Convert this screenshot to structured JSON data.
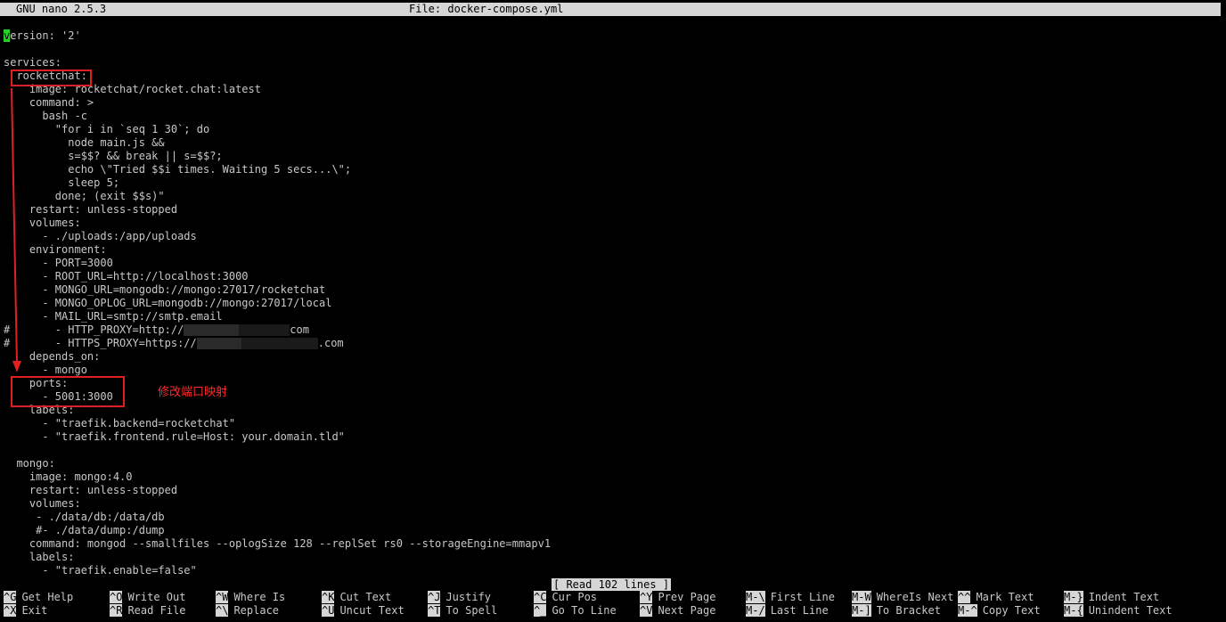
{
  "titlebar": {
    "app": "GNU nano 2.5.3",
    "file": "File: docker-compose.yml"
  },
  "editor": {
    "first_char": "v",
    "first_rest": "ersion: '2'",
    "lines": [
      "",
      "services:",
      "  rocketchat:",
      "    image: rocketchat/rocket.chat:latest",
      "    command: >",
      "      bash -c",
      "        \"for i in `seq 1 30`; do",
      "          node main.js &&",
      "          s=$$? && break || s=$$?;",
      "          echo \\\"Tried $$i times. Waiting 5 secs...\\\";",
      "          sleep 5;",
      "        done; (exit $$s)\"",
      "    restart: unless-stopped",
      "    volumes:",
      "      - ./uploads:/app/uploads",
      "    environment:",
      "      - PORT=3000",
      "      - ROOT_URL=http://localhost:3000",
      "      - MONGO_URL=mongodb://mongo:27017/rocketchat",
      "      - MONGO_OPLOG_URL=mongodb://mongo:27017/local",
      "      - MAIL_URL=smtp://smtp.email"
    ],
    "proxy_lines": [
      {
        "prefix": "#       - HTTP_PROXY=http://",
        "suffix": "com"
      },
      {
        "prefix": "#       - HTTPS_PROXY=https://",
        "suffix": ".com"
      }
    ],
    "lines2": [
      "    depends_on:",
      "      - mongo",
      "    ports:",
      "      - 5001:3000",
      "    labels:",
      "      - \"traefik.backend=rocketchat\"",
      "      - \"traefik.frontend.rule=Host: your.domain.tld\"",
      "",
      "  mongo:",
      "    image: mongo:4.0",
      "    restart: unless-stopped",
      "    volumes:",
      "     - ./data/db:/data/db",
      "     #- ./data/dump:/dump",
      "    command: mongod --smallfiles --oplogSize 128 --replSet rs0 --storageEngine=mmapv1",
      "    labels:",
      "      - \"traefik.enable=false\""
    ]
  },
  "status": "[ Read 102 lines ]",
  "shortcuts": [
    [
      {
        "key": "^G",
        "label": "Get Help"
      },
      {
        "key": "^X",
        "label": "Exit"
      }
    ],
    [
      {
        "key": "^O",
        "label": "Write Out"
      },
      {
        "key": "^R",
        "label": "Read File"
      }
    ],
    [
      {
        "key": "^W",
        "label": "Where Is"
      },
      {
        "key": "^\\",
        "label": "Replace"
      }
    ],
    [
      {
        "key": "^K",
        "label": "Cut Text"
      },
      {
        "key": "^U",
        "label": "Uncut Text"
      }
    ],
    [
      {
        "key": "^J",
        "label": "Justify"
      },
      {
        "key": "^T",
        "label": "To Spell"
      }
    ],
    [
      {
        "key": "^C",
        "label": "Cur Pos"
      },
      {
        "key": "^_",
        "label": "Go To Line"
      }
    ],
    [
      {
        "key": "^Y",
        "label": "Prev Page"
      },
      {
        "key": "^V",
        "label": "Next Page"
      }
    ],
    [
      {
        "key": "M-\\",
        "label": "First Line"
      },
      {
        "key": "M-/",
        "label": "Last Line"
      }
    ],
    [
      {
        "key": "M-W",
        "label": "WhereIs Next"
      },
      {
        "key": "M-]",
        "label": "To Bracket"
      }
    ],
    [
      {
        "key": "^^",
        "label": "Mark Text"
      },
      {
        "key": "M-^",
        "label": "Copy Text"
      }
    ],
    [
      {
        "key": "M-}",
        "label": "Indent Text"
      },
      {
        "key": "M-{",
        "label": "Unindent Text"
      }
    ]
  ],
  "annotation": {
    "text": "修改端口映射",
    "color": "#e02020"
  }
}
